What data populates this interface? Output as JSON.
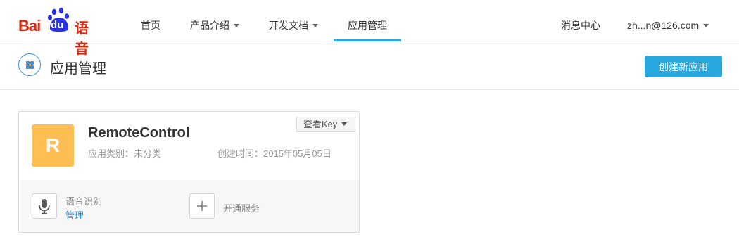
{
  "logo": {
    "bai": "Bai",
    "du": "du",
    "product": "语音"
  },
  "nav": {
    "items": [
      {
        "label": "首页"
      },
      {
        "label": "产品介绍"
      },
      {
        "label": "开发文档"
      },
      {
        "label": "应用管理"
      }
    ],
    "messages": "消息中心",
    "user": "zh...n@126.com"
  },
  "header": {
    "title": "应用管理",
    "create_button": "创建新应用"
  },
  "app": {
    "initial": "R",
    "name": "RemoteControl",
    "category": "应用类别：未分类",
    "created": "创建时间：2015年05月05日",
    "view_key": "查看Key"
  },
  "services": {
    "speech_name": "语音识别",
    "speech_manage": "管理",
    "open_service": "开通服务"
  },
  "colors": {
    "brand_red": "#de2910",
    "brand_blue": "#2932e1",
    "accent": "#29a8e0",
    "avatar": "#fdbf54",
    "link": "#2a8fd1"
  }
}
